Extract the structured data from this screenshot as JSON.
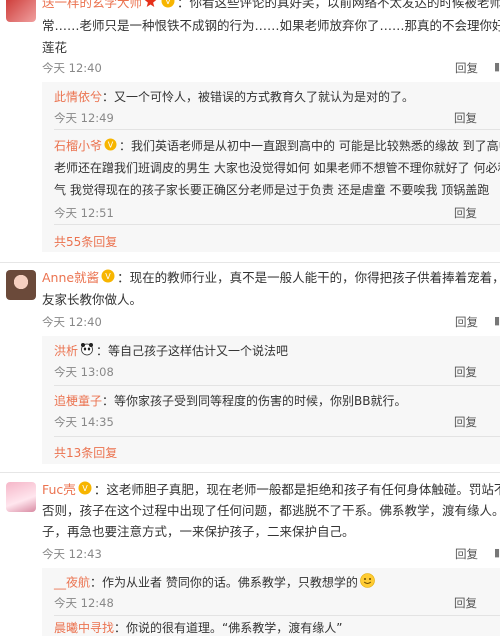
{
  "reply_label": "回复",
  "like_glyph": "赞",
  "comments": [
    {
      "user": "送一样的玄学大师",
      "text_lines": [
        "：你看这些评论的真好笑，以前网络不太发达的时候被老师扭耳朵",
        "常……老师只是一种恨铁不成钢的行为……如果老师放弃你了……那真的不会理你好吗……一群",
        "莲花"
      ],
      "time": "今天 12:40",
      "replies": [
        {
          "user": "此情依兮",
          "text_lines": [
            "：又一个可怜人，被错误的方式教育久了就认为是对的了。"
          ],
          "time": "今天 12:49"
        },
        {
          "user": "石榴小爷",
          "text_lines": [
            "：我们英语老师是从初中一直跟到高中的 可能是比较熟悉的缘故 到了高中 英",
            "老师还在蹭我们班调皮的男生 大家也没觉得如何 如果老师不想管不理你就好了 何必和你生",
            "气 我觉得现在的孩子家长要正确区分老师是过于负责 还是虐童 不要唉我 顶锅盖跑"
          ],
          "time": "今天 12:51"
        }
      ],
      "more": "共55条回复"
    },
    {
      "user": "Anne就酱",
      "text_lines": [
        "：现在的教师行业，真不是一般人能干的，你得把孩子供着捧着宠着，不然分分",
        "友家长教你做人。"
      ],
      "time": "今天 12:40",
      "replies": [
        {
          "user": "洪析",
          "text_lines": [
            "：等自己孩子这样估计又一个说法吧"
          ],
          "time": "今天 13:08"
        },
        {
          "user": "追梗童子",
          "text_lines": [
            "：等你家孩子受到同等程度的伤害的时候，你别BB就行。"
          ],
          "time": "今天 14:35"
        }
      ],
      "more": "共13条回复"
    },
    {
      "user": "Fuc壳",
      "text_lines": [
        "：这老师胆子真肥，现在老师一般都是拒绝和孩子有任何身体触碰。罚站不超过三",
        "否则，孩子在这个过程中出现了任何问题，都逃脱不了干系。佛系教学，渡有缘人。不要气坏了",
        "子，再急也要注意方式，一来保护孩子，二来保护自己。"
      ],
      "time": "今天 12:43",
      "replies": [
        {
          "user": "__夜航",
          "text_lines": [
            "：作为从业者 赞同你的话。佛系教学，只教想学的"
          ],
          "time": "今天 12:48"
        },
        {
          "user": "晨曦中寻找",
          "text_lines": [
            "：你说的很有道理。“佛系教学，渡有缘人”"
          ],
          "time": ""
        }
      ],
      "more": ""
    }
  ]
}
